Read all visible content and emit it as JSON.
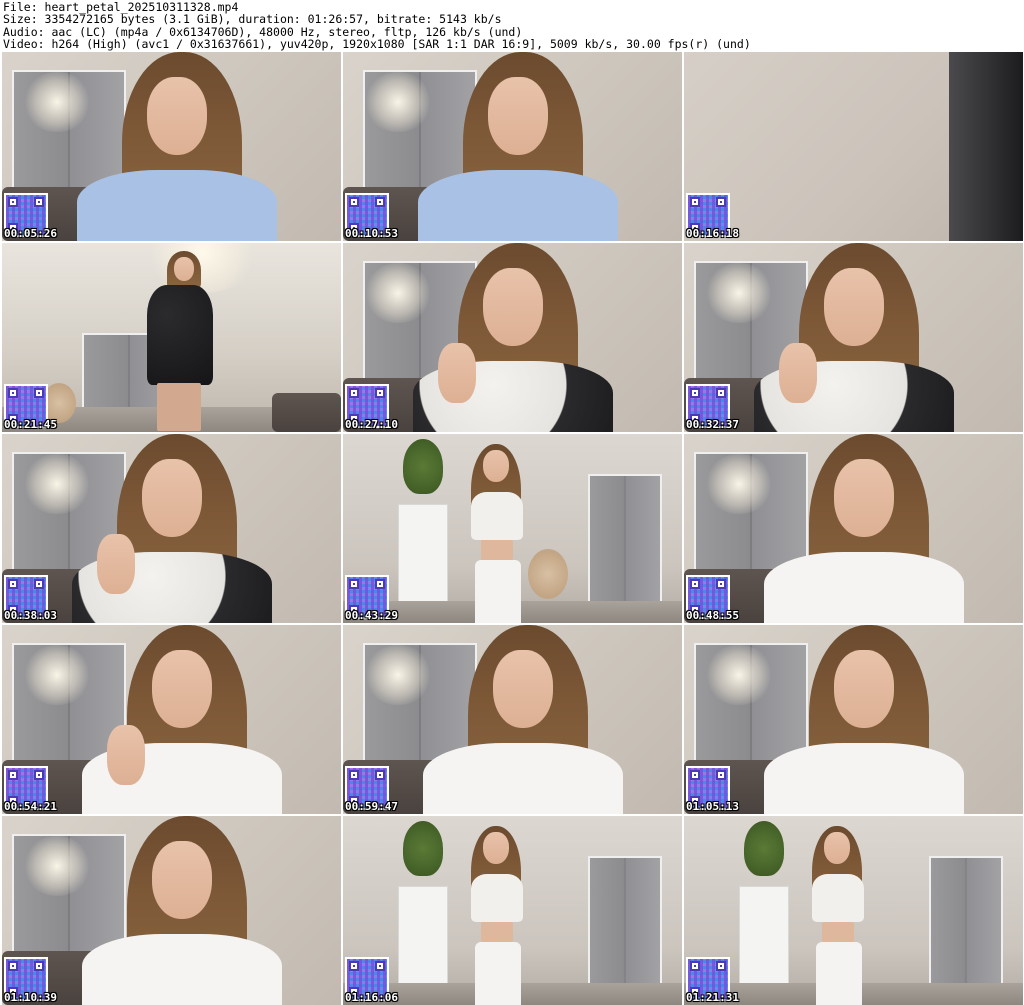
{
  "header": {
    "line1": "File: heart_petal_202510311328.mp4",
    "line2": "Size: 3354272165 bytes (3.1 GiB), duration: 01:26:57, bitrate: 5143 kb/s",
    "line3": "Audio: aac (LC) (mp4a / 0x6134706D), 48000 Hz, stereo, fltp, 126 kb/s (und)",
    "line4": "Video: h264 (High) (avc1 / 0x31637661), yuv420p, 1920x1080 [SAR 1:1 DAR 16:9], 5009 kb/s, 30.00 fps(r) (und)"
  },
  "thumbnails": [
    {
      "timestamp": "00:05:26",
      "scene": "closeup-blue"
    },
    {
      "timestamp": "00:10:53",
      "scene": "closeup-blue"
    },
    {
      "timestamp": "00:16:18",
      "scene": "empty-wall"
    },
    {
      "timestamp": "00:21:45",
      "scene": "standing-dress"
    },
    {
      "timestamp": "00:27:10",
      "scene": "closeup-dress"
    },
    {
      "timestamp": "00:32:37",
      "scene": "closeup-dress"
    },
    {
      "timestamp": "00:38:03",
      "scene": "closeup-dress"
    },
    {
      "timestamp": "00:43:29",
      "scene": "standing-white"
    },
    {
      "timestamp": "00:48:55",
      "scene": "closeup-white"
    },
    {
      "timestamp": "00:54:21",
      "scene": "closeup-white"
    },
    {
      "timestamp": "00:59:47",
      "scene": "closeup-white"
    },
    {
      "timestamp": "01:05:13",
      "scene": "closeup-white"
    },
    {
      "timestamp": "01:10:39",
      "scene": "closeup-white"
    },
    {
      "timestamp": "01:16:06",
      "scene": "standing-white"
    },
    {
      "timestamp": "01:21:31",
      "scene": "standing-white"
    }
  ]
}
